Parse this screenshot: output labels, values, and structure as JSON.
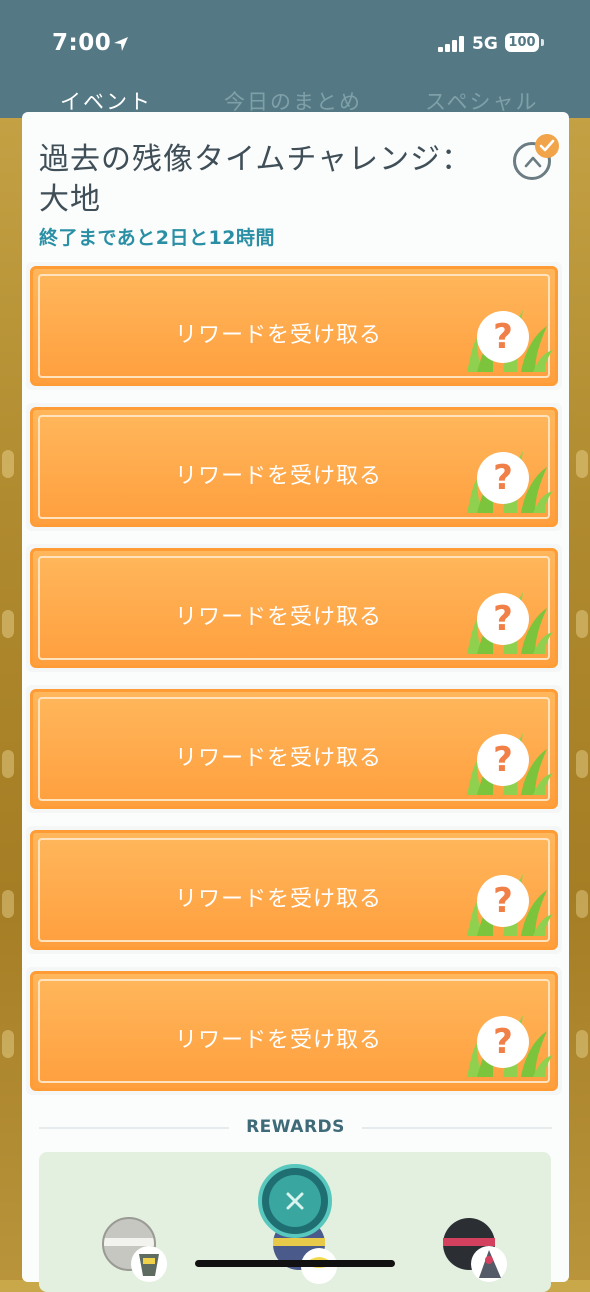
{
  "status_bar": {
    "time": "7:00",
    "network": "5G",
    "battery": "100"
  },
  "tabs": [
    {
      "label": "イベント",
      "active": true
    },
    {
      "label": "今日のまとめ",
      "active": false
    },
    {
      "label": "スペシャル",
      "active": false
    }
  ],
  "event": {
    "title_line1": "過去の残像タイムチャレンジ：",
    "title_line2": "大地",
    "time_remaining": "終了まであと2日と12時間",
    "completed": true
  },
  "reward_buttons": [
    {
      "label": "リワードを受け取る",
      "icon": "mystery-reward-icon"
    },
    {
      "label": "リワードを受け取る",
      "icon": "mystery-reward-icon"
    },
    {
      "label": "リワードを受け取る",
      "icon": "mystery-reward-icon"
    },
    {
      "label": "リワードを受け取る",
      "icon": "mystery-reward-icon"
    },
    {
      "label": "リワードを受け取る",
      "icon": "mystery-reward-icon"
    },
    {
      "label": "リワードを受け取る",
      "icon": "mystery-reward-icon"
    }
  ],
  "rewards_section": {
    "heading": "REWARDS",
    "items": [
      "timed-research-ball-icon",
      "timed-research-ball-icon",
      "timed-research-ball-icon"
    ]
  },
  "colors": {
    "header": "#547985",
    "button_orange": "#ff9f3e",
    "accent_teal": "#2a8fa4",
    "rewards_bg": "#e3f0e0"
  }
}
